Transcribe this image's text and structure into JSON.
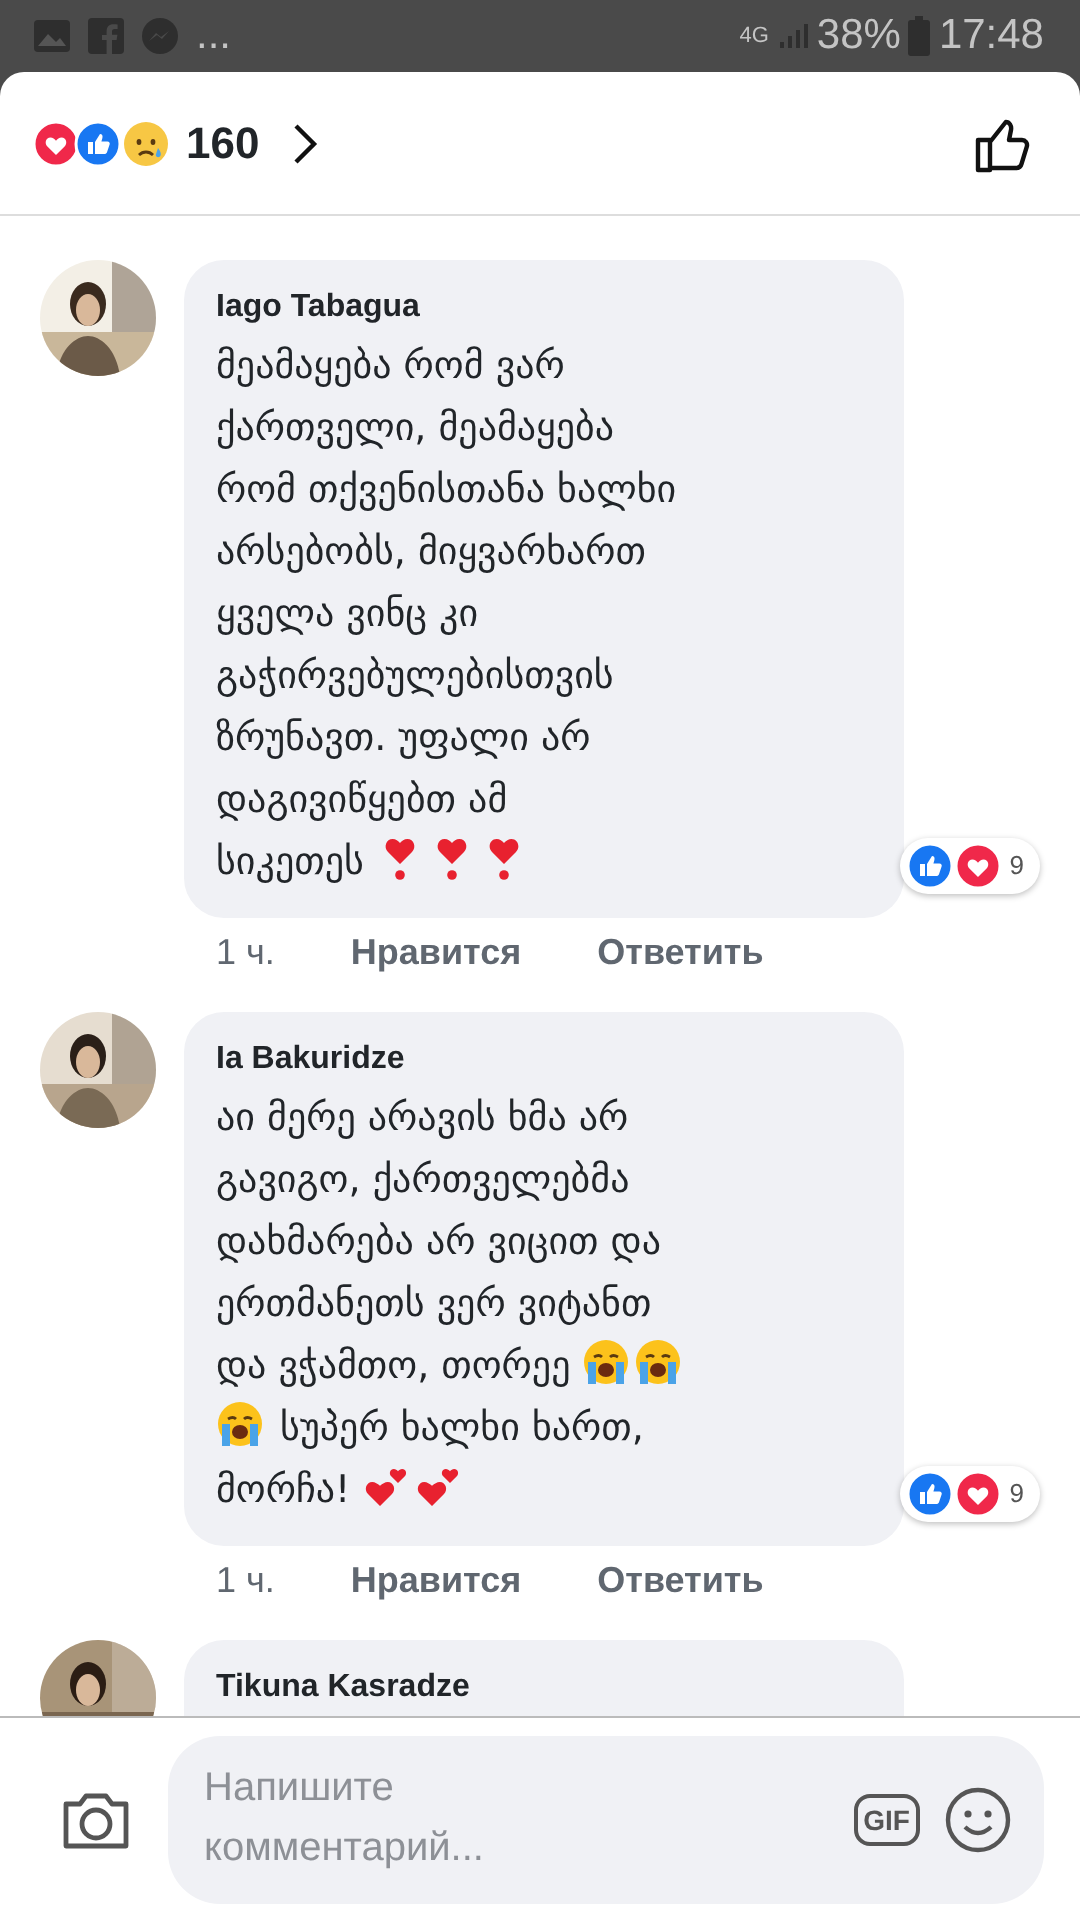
{
  "status_bar": {
    "more": "...",
    "network": "4G",
    "battery": "38%",
    "time": "17:48"
  },
  "reactions_header": {
    "count": "160"
  },
  "comments": [
    {
      "author": "Iago Tabagua",
      "body": [
        {
          "kind": "text",
          "text": "მეამაყება რომ ვარ\nქართველი, მეამაყება\nრომ თქვენისთანა ხალხი\nარსებობს, მიყვარხართ\nყველა ვინც კი\nგაჭირვებულებისთვის\nზრუნავთ. უფალი არ\nდაგივიწყებთ ამ\nსიკეთეს "
        },
        {
          "kind": "heart-exclamation"
        },
        {
          "kind": "heart-exclamation"
        },
        {
          "kind": "heart-exclamation"
        }
      ],
      "reaction_count": "9",
      "time": "1 ч.",
      "like": "Нравится",
      "reply": "Ответить"
    },
    {
      "author": "Ia Bakuridze",
      "body": [
        {
          "kind": "text",
          "text": "აი მერე არავის ხმა არ\nგავიგო, ქართველებმა\nდახმარება არ ვიცით და\nერთმანეთს ვერ ვიტანთ\nდა ვჭამთო, თორეე "
        },
        {
          "kind": "crying-face"
        },
        {
          "kind": "crying-face"
        },
        {
          "kind": "line-break"
        },
        {
          "kind": "crying-face"
        },
        {
          "kind": "text",
          "text": " სუპერ ხალხი ხართ,\nმორჩა! "
        },
        {
          "kind": "two-hearts"
        },
        {
          "kind": "two-hearts"
        }
      ],
      "reaction_count": "9",
      "time": "1 ч.",
      "like": "Нравится",
      "reply": "Ответить"
    },
    {
      "author": "Tikuna Kasradze"
    }
  ],
  "composer": {
    "placeholder": "Напишите комментарий...",
    "gif": "GIF"
  }
}
